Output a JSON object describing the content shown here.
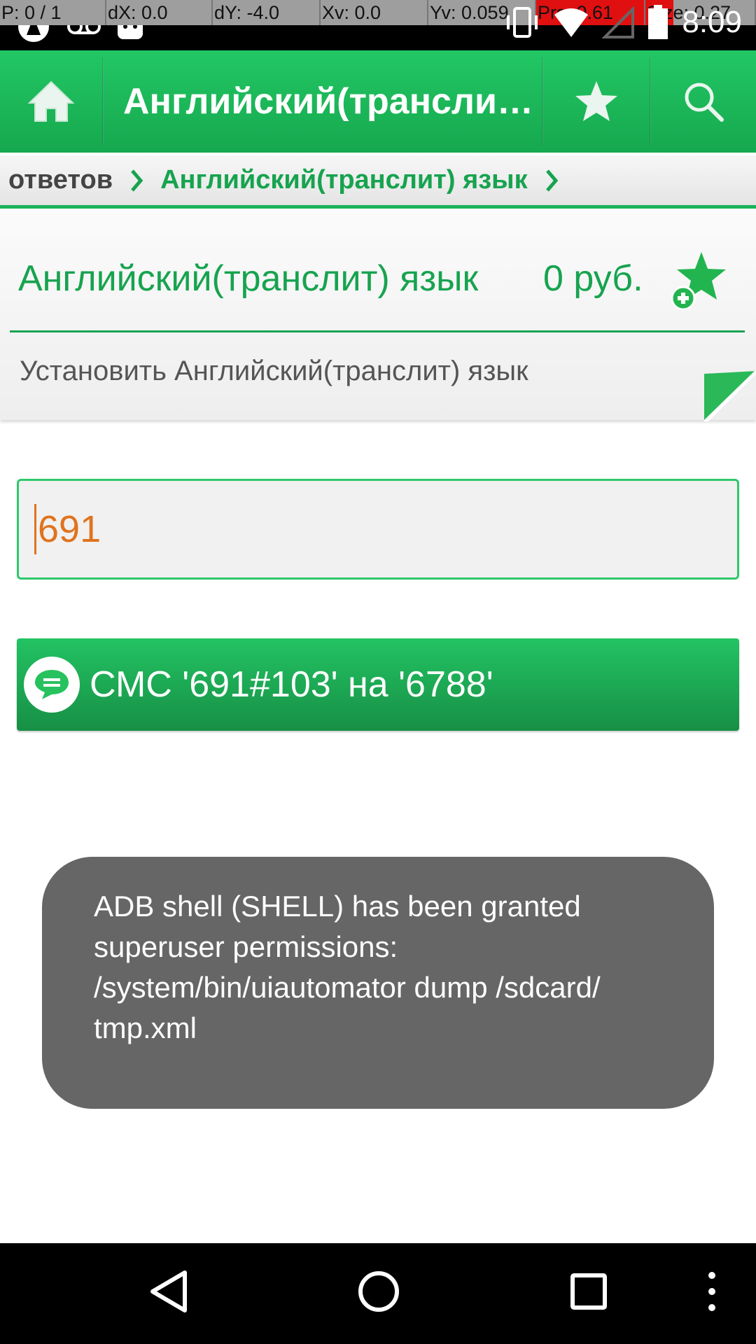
{
  "status_bar": {
    "debug": [
      "P: 0 / 1",
      "dX: 0.0",
      "dY: -4.0",
      "Xv: 0.0",
      "Yv: 0.059",
      "Prs: 0.61",
      "Size: 0.27"
    ],
    "time": "8:09",
    "icons": [
      "signal-app-icon",
      "voicemail-icon",
      "android-icon",
      "vibrate-icon",
      "wifi-icon",
      "cell-signal-icon",
      "battery-icon"
    ]
  },
  "toolbar": {
    "title": "Английский(транслит) язык",
    "home_icon": "home-icon",
    "favorite_icon": "star-icon",
    "search_icon": "search-icon"
  },
  "breadcrumb": {
    "items": [
      "ответов",
      "Английский(транслит) язык"
    ]
  },
  "card": {
    "title": "Английский(транслит) язык",
    "price": "0 руб.",
    "subtitle": "Установить Английский(транслит) язык",
    "add_favorite_icon": "star-plus-icon"
  },
  "input": {
    "value": "691"
  },
  "sms_button": {
    "label": "СМС '691#103' на '6788'",
    "icon": "chat-bubble-icon"
  },
  "toast": {
    "lines": [
      "ADB shell (SHELL) has been granted",
      "superuser permissions:",
      "",
      "/system/bin/uiautomator dump /sdcard/",
      "tmp.xml"
    ]
  },
  "navbar": {
    "icons": [
      "back-icon",
      "home-circle-icon",
      "recents-icon",
      "overflow-menu-icon"
    ]
  },
  "colors": {
    "accent": "#17a34f",
    "input_text": "#e0731e",
    "toast_bg": "#666666"
  }
}
